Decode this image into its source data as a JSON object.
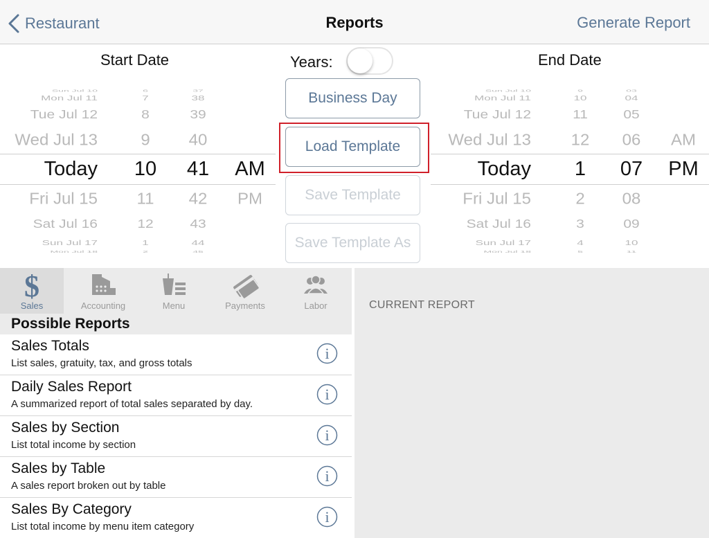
{
  "nav": {
    "back_label": "Restaurant",
    "title": "Reports",
    "action_label": "Generate Report"
  },
  "start": {
    "label": "Start Date",
    "days": [
      "Sun Jul 10",
      "Mon Jul 11",
      "Tue Jul 12",
      "Wed Jul 13",
      "Today",
      "Fri Jul 15",
      "Sat Jul 16",
      "Sun Jul 17",
      "Mon Jul 18"
    ],
    "hours": [
      "6",
      "7",
      "8",
      "9",
      "10",
      "11",
      "12",
      "1",
      "2"
    ],
    "minutes": [
      "37",
      "38",
      "39",
      "40",
      "41",
      "42",
      "43",
      "44",
      "45"
    ],
    "ampm": [
      "AM",
      "PM"
    ]
  },
  "end": {
    "label": "End Date",
    "days": [
      "Sun Jul 10",
      "Mon Jul 11",
      "Tue Jul 12",
      "Wed Jul 13",
      "Today",
      "Fri Jul 15",
      "Sat Jul 16",
      "Sun Jul 17",
      "Mon Jul 18"
    ],
    "hours": [
      "9",
      "10",
      "11",
      "12",
      "1",
      "2",
      "3",
      "4",
      "5"
    ],
    "minutes": [
      "03",
      "04",
      "05",
      "06",
      "07",
      "08",
      "09",
      "10",
      "11"
    ],
    "ampm": [
      "AM",
      "PM"
    ]
  },
  "years": {
    "label": "Years:",
    "on": false
  },
  "buttons": {
    "business_day": "Business Day",
    "load_template": "Load Template",
    "save_template": "Save Template",
    "save_template_as": "Save Template As"
  },
  "tabs": [
    {
      "label": "Sales",
      "icon": "dollar-icon",
      "active": true
    },
    {
      "label": "Accounting",
      "icon": "cash-register-icon",
      "active": false
    },
    {
      "label": "Menu",
      "icon": "drink-menu-icon",
      "active": false
    },
    {
      "label": "Payments",
      "icon": "credit-card-icon",
      "active": false
    },
    {
      "label": "Labor",
      "icon": "people-icon",
      "active": false
    }
  ],
  "reports": {
    "header": "Possible Reports",
    "items": [
      {
        "title": "Sales Totals",
        "subtitle": "List sales, gratuity, tax, and gross totals"
      },
      {
        "title": "Daily Sales Report",
        "subtitle": "A summarized report of total sales separated by day."
      },
      {
        "title": "Sales by Section",
        "subtitle": "List total income by section"
      },
      {
        "title": "Sales by Table",
        "subtitle": "A sales report broken out by table"
      },
      {
        "title": "Sales By Category",
        "subtitle": "List total income by menu item category"
      }
    ]
  },
  "current_report": {
    "label": "CURRENT REPORT"
  },
  "colors": {
    "accent": "#5b7796",
    "highlight": "#d0202a",
    "panel_bg": "#ebebeb"
  }
}
